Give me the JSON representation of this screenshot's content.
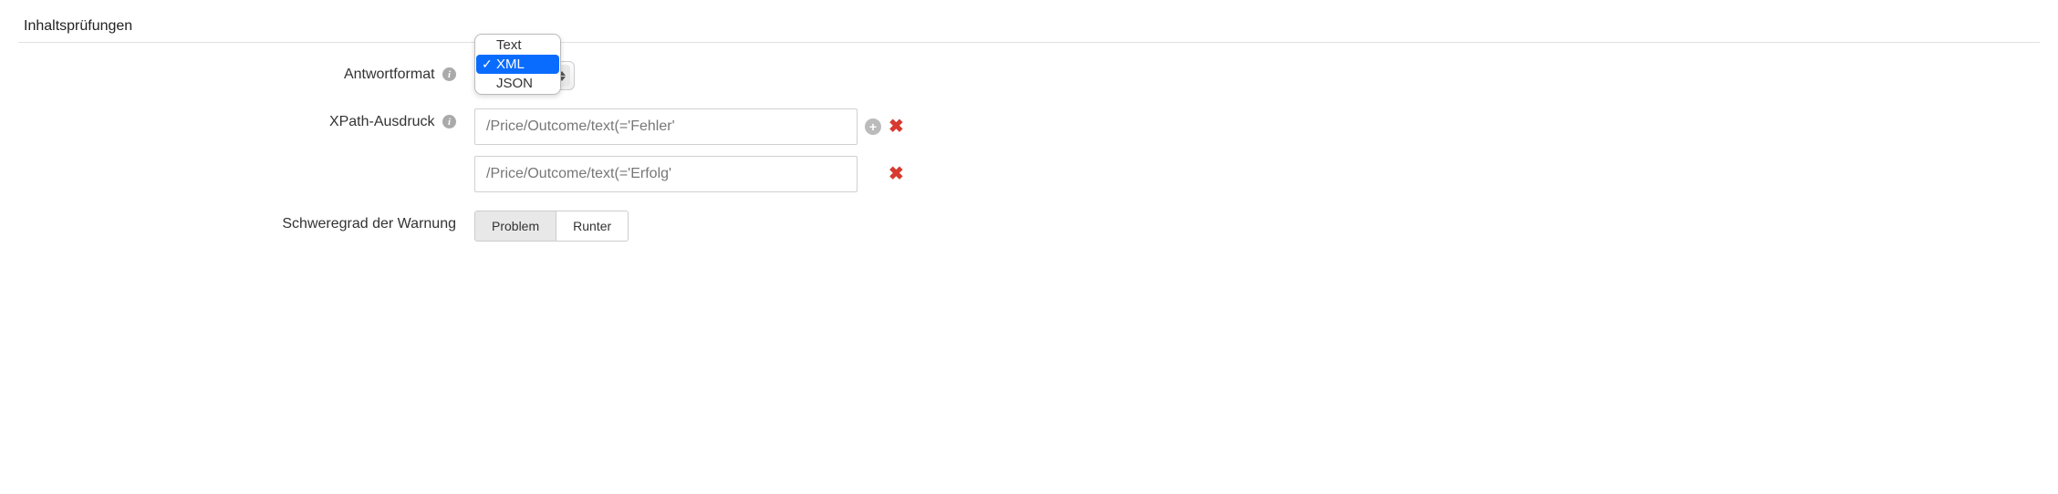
{
  "section": {
    "title": "Inhaltsprüfungen"
  },
  "responseFormat": {
    "label": "Antwortformat",
    "options": {
      "text": "Text",
      "xml": "XML",
      "json": "JSON"
    },
    "selected": "XML"
  },
  "xpath": {
    "label": "XPath-Ausdruck",
    "values": [
      "/Price/Outcome/text(='Fehler'",
      "/Price/Outcome/text(='Erfolg'"
    ]
  },
  "severity": {
    "label": "Schweregrad der Warnung",
    "options": {
      "problem": "Problem",
      "down": "Runter"
    },
    "selected": "Problem"
  }
}
